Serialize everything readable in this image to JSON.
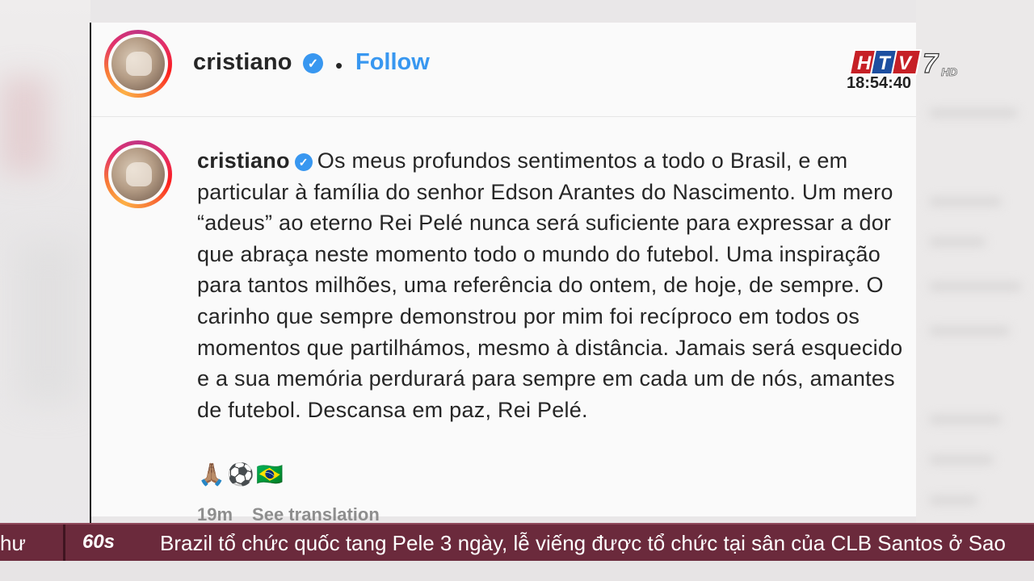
{
  "post": {
    "username": "cristiano",
    "verified_icon": "verified-badge-icon",
    "separator": "•",
    "follow_label": "Follow",
    "caption_text": "Os meus profundos sentimentos a todo o Brasil, e em particular à família do senhor Edson Arantes do Nascimento. Um mero “adeus” ao eterno Rei Pelé nunca será suficiente para expressar a dor que abraça neste momento todo o mundo do futebol. Uma inspiração para tantos milhões, uma referência do ontem, de hoje, de sempre. O carinho que sempre demonstrou por mim foi recíproco em todos os momentos que partilhámos, mesmo à distância. Jamais será esquecido e a sua memória perdurará para sempre em cada um de nós, amantes de futebol. Descansa em paz, Rei Pelé.",
    "emojis": [
      "🙏🏽",
      "⚽",
      "🇧🇷"
    ],
    "time_ago": "19m",
    "see_translation": "See translation"
  },
  "broadcast": {
    "channel_logo": "HTV7",
    "channel_hd": "HD",
    "clock": "18:54:40",
    "ticker_prefix": "hư",
    "ticker_logo": "60s",
    "ticker_text": "Brazil tổ chức quốc tang Pele 3 ngày, lễ viếng được tổ chức tại sân của CLB Santos ở Sao"
  },
  "colors": {
    "accent": "#3897f0",
    "ticker": "#6b2a3c",
    "text": "#262626"
  }
}
